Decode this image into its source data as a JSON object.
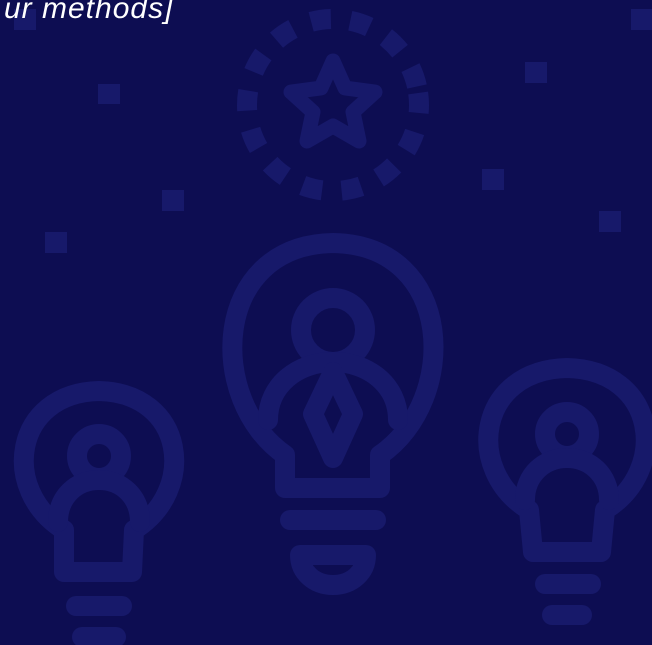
{
  "headline": "ur methods]",
  "colors": {
    "background": "#0d0d52",
    "icon": "#17196a",
    "text": "#ffffff"
  },
  "decor_icons": [
    "star-badge-icon",
    "lightbulb-icon",
    "lightbulb-icon",
    "lightbulb-icon",
    "confetti-square-icon"
  ]
}
